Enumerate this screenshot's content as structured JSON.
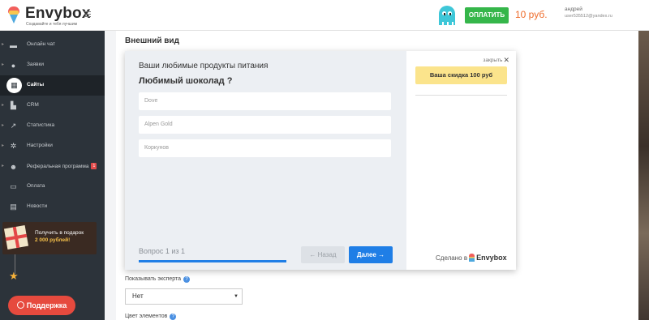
{
  "brand": {
    "name": "Envybox",
    "tagline": "Создавайте и тебя лучшим"
  },
  "header": {
    "pay_label": "ОПЛАТИТЬ",
    "balance": "10 руб.",
    "user_name": "андрей",
    "user_email": "user535512@yandex.ru"
  },
  "sidebar": {
    "items": [
      {
        "label": "Онлайн чат",
        "icon": "chat-icon"
      },
      {
        "label": "Заявки",
        "icon": "user-icon"
      },
      {
        "label": "Сайты",
        "icon": "grid-icon",
        "active": true
      },
      {
        "label": "CRM",
        "icon": "crm-icon"
      },
      {
        "label": "Статистика",
        "icon": "chart-icon"
      },
      {
        "label": "Настройки",
        "icon": "gear-icon"
      },
      {
        "label": "Реферальная программа",
        "icon": "people-icon",
        "badge": "1"
      },
      {
        "label": "Оплата",
        "icon": "card-icon"
      },
      {
        "label": "Новости",
        "icon": "news-icon"
      }
    ],
    "promo_line1": "Получить в подарок",
    "promo_line2": "2 000 рублей!",
    "support_label": "Поддержка"
  },
  "main": {
    "section_title": "Внешний вид"
  },
  "widget": {
    "quiz_title": "Ваши любимые продукты питания",
    "question": "Любимый шоколад ?",
    "options": [
      "Dove",
      "Alpen Gold",
      "Коркунов"
    ],
    "progress_label": "Вопрос 1 из 1",
    "progress_fraction": 1.0,
    "back_label": "Назад",
    "next_label": "Далее",
    "close_label": "закрыть",
    "discount_label": "Ваша скидка 100 руб",
    "made_by_prefix": "Сделано в",
    "made_by_brand": "Envybox",
    "accent_color": "#1f7ee6"
  },
  "settings": {
    "show_expert_label": "Показывать эксперта",
    "show_expert_value": "Нет",
    "elements_color_label": "Цвет элементов"
  }
}
